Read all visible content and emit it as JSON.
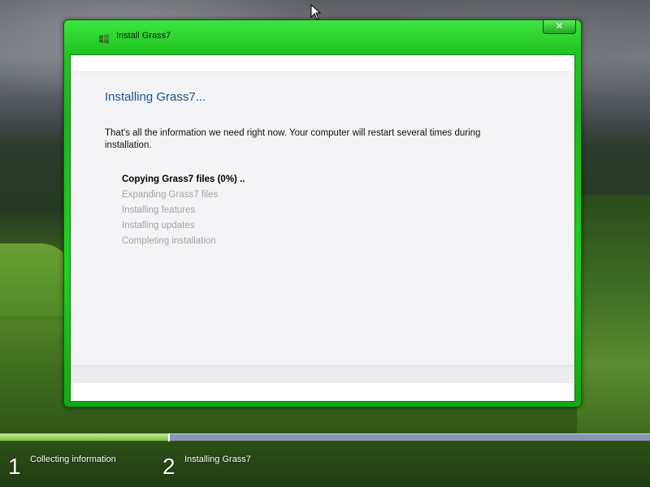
{
  "window": {
    "title": "Install Grass7",
    "close_label": "✕",
    "icon": "grass7-flag-icon",
    "accent_color": "#22c622"
  },
  "main": {
    "heading": "Installing Grass7...",
    "info_text": "That's all the information we need right now. Your computer will restart several times during installation.",
    "steps": [
      {
        "label": "Copying Grass7 files (0%) ..",
        "active": true
      },
      {
        "label": "Expanding Grass7 files",
        "active": false
      },
      {
        "label": "Installing features",
        "active": false
      },
      {
        "label": "Installing updates",
        "active": false
      },
      {
        "label": "Completing installation",
        "active": false
      }
    ]
  },
  "progress": {
    "fill_fraction": 0.26,
    "fill_color": "#7cc43e",
    "track_color": "#8797b0",
    "phases": [
      {
        "number": "1",
        "label": "Collecting information"
      },
      {
        "number": "2",
        "label": "Installing Grass7"
      }
    ]
  },
  "icons": {
    "cursor": "arrow-cursor-icon"
  }
}
